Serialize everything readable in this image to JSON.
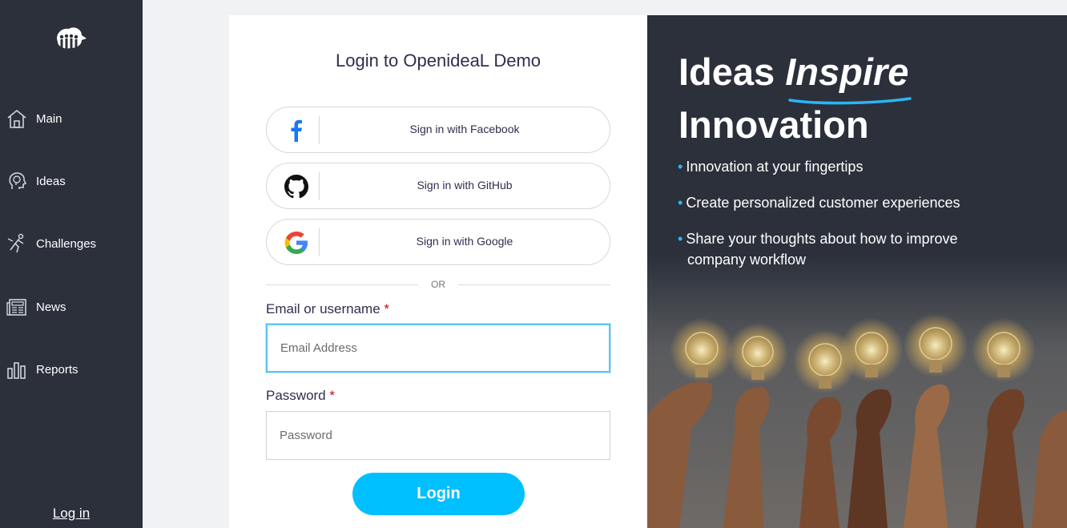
{
  "sidebar": {
    "items": [
      {
        "label": "Main",
        "icon": "home-icon"
      },
      {
        "label": "Ideas",
        "icon": "lightbulb-head-icon"
      },
      {
        "label": "Challenges",
        "icon": "challenge-runner-icon"
      },
      {
        "label": "News",
        "icon": "newspaper-icon"
      },
      {
        "label": "Reports",
        "icon": "bar-chart-icon"
      }
    ],
    "login_link": "Log in"
  },
  "form": {
    "title": "Login to OpenideaL Demo",
    "facebook_label": "Sign in with Facebook",
    "github_label": "Sign in with GitHub",
    "google_label": "Sign in with Google",
    "or_text": "OR",
    "email_label": "Email or username",
    "email_placeholder": "Email Address",
    "password_label": "Password",
    "password_placeholder": "Password",
    "required_mark": "*",
    "login_button": "Login"
  },
  "hero": {
    "title_word1": "Ideas",
    "title_word2": "Inspire",
    "title_line2": "Innovation",
    "bullets": [
      {
        "text": "Innovation at your fingertips"
      },
      {
        "text": "Create personalized customer experiences"
      },
      {
        "text": "Share your thoughts about how to improve",
        "cont": "company workflow"
      }
    ]
  },
  "colors": {
    "sidebar_bg": "#2b303b",
    "accent": "#00bfff",
    "required": "#d0021b",
    "title_text": "#2f2e4e"
  }
}
